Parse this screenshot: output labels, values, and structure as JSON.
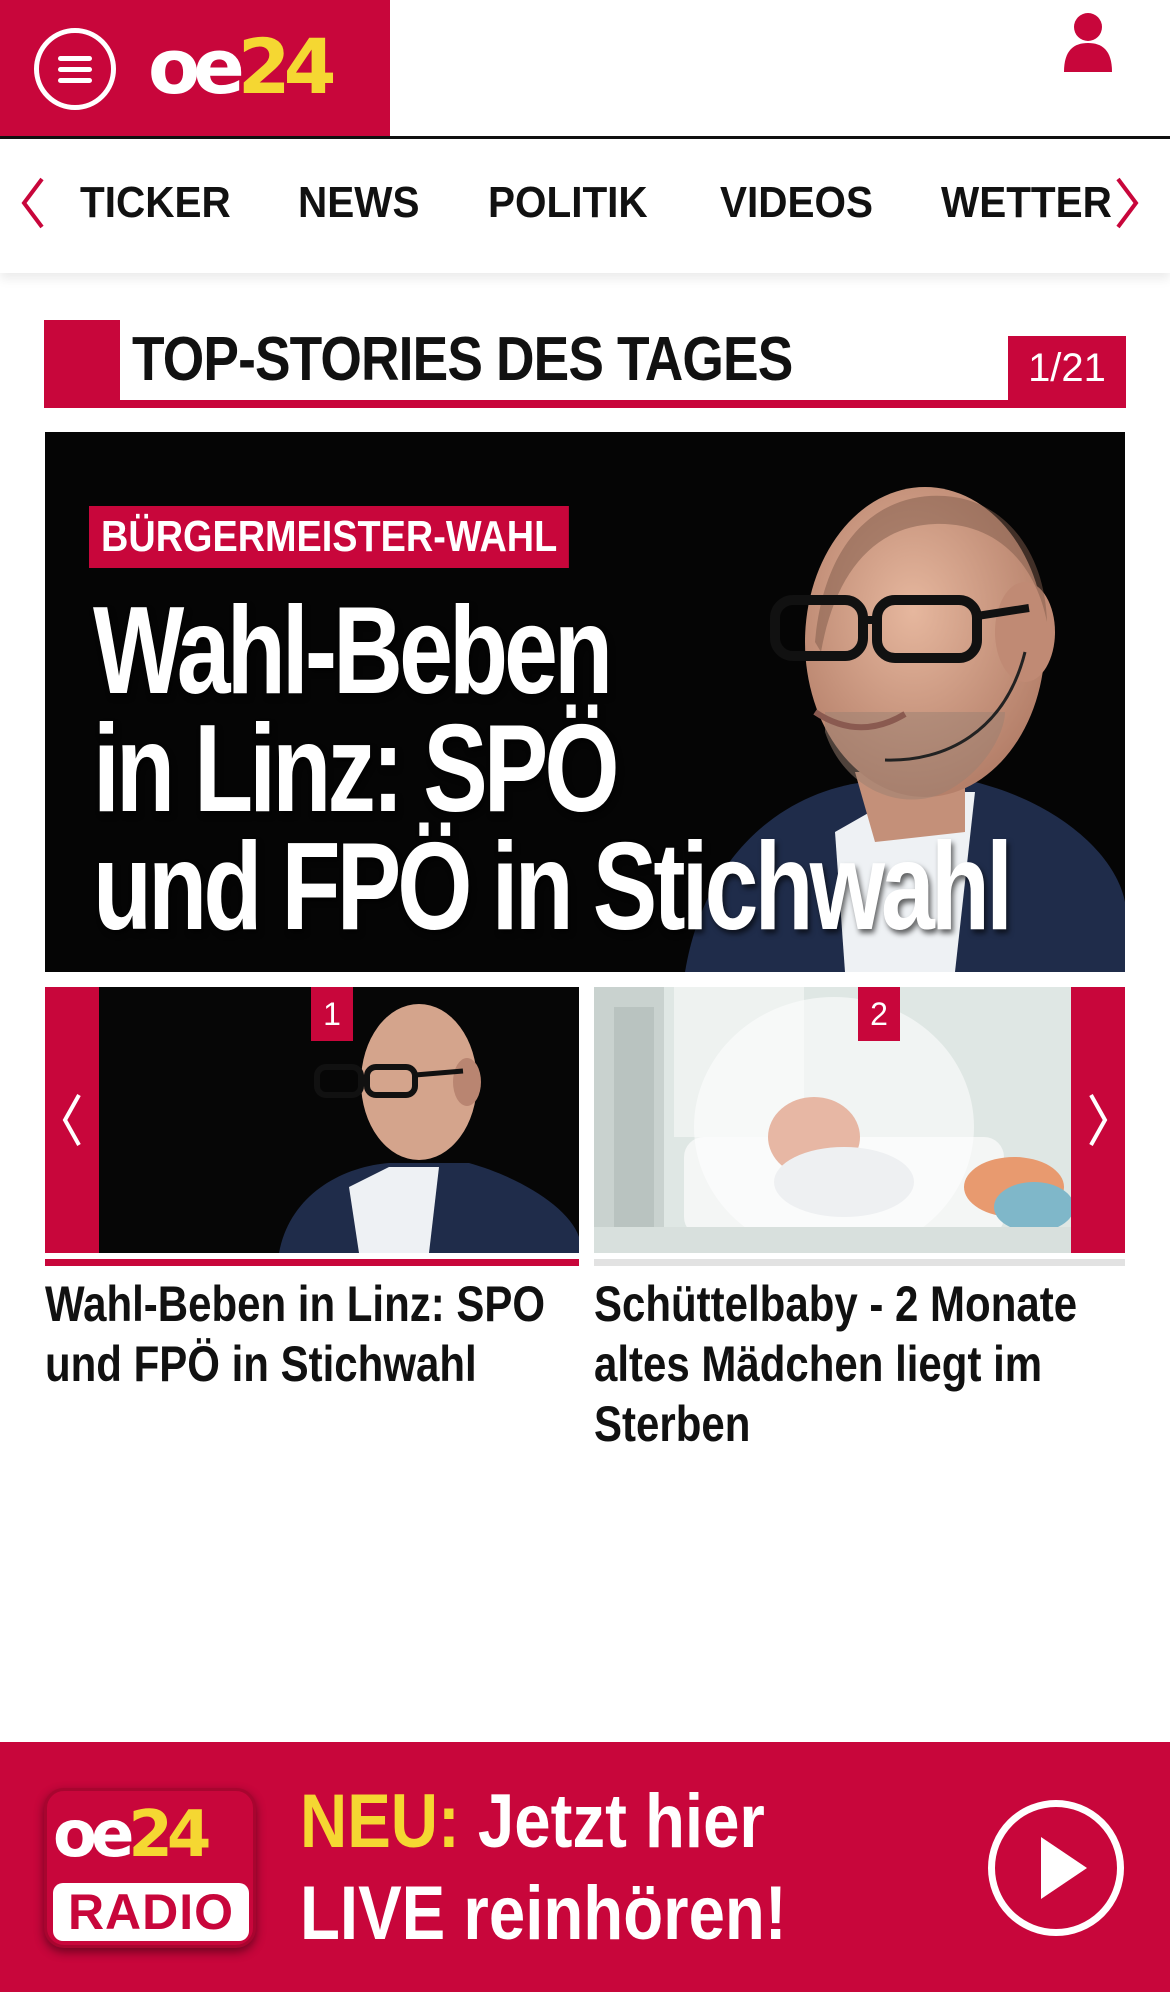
{
  "header": {
    "logo_main": "oe",
    "logo_num": "24",
    "brand_color": "#c8063b",
    "logo_accent_color": "#f5d732",
    "icons": [
      "menu-icon",
      "user-icon"
    ]
  },
  "nav": {
    "items": [
      "TICKER",
      "NEWS",
      "POLITIK",
      "VIDEOS",
      "WETTER"
    ],
    "icons": [
      "chevron-left-icon",
      "chevron-right-icon"
    ]
  },
  "section": {
    "title": "TOP-STORIES DES TAGES",
    "counter": "1/21"
  },
  "hero": {
    "kicker": "BÜRGERMEISTER-WAHL",
    "headline_lines": [
      "Wahl-Beben",
      "in Linz: SPÖ",
      "und FPÖ in Stichwahl"
    ]
  },
  "carousel": {
    "items": [
      {
        "badge": "1",
        "caption": "Wahl-Beben in Linz: SPO und FPÖ in Stichwahl"
      },
      {
        "badge": "2",
        "caption": "Schüttelbaby - 2 Monate altes Mädchen liegt im Sterben"
      }
    ]
  },
  "radio_banner": {
    "logo_main": "oe",
    "logo_num": "24",
    "logo_label": "RADIO",
    "highlight": "NEU:",
    "line1_rest": " Jetzt hier",
    "line2": "LIVE reinhören!",
    "icon": "play-icon"
  }
}
